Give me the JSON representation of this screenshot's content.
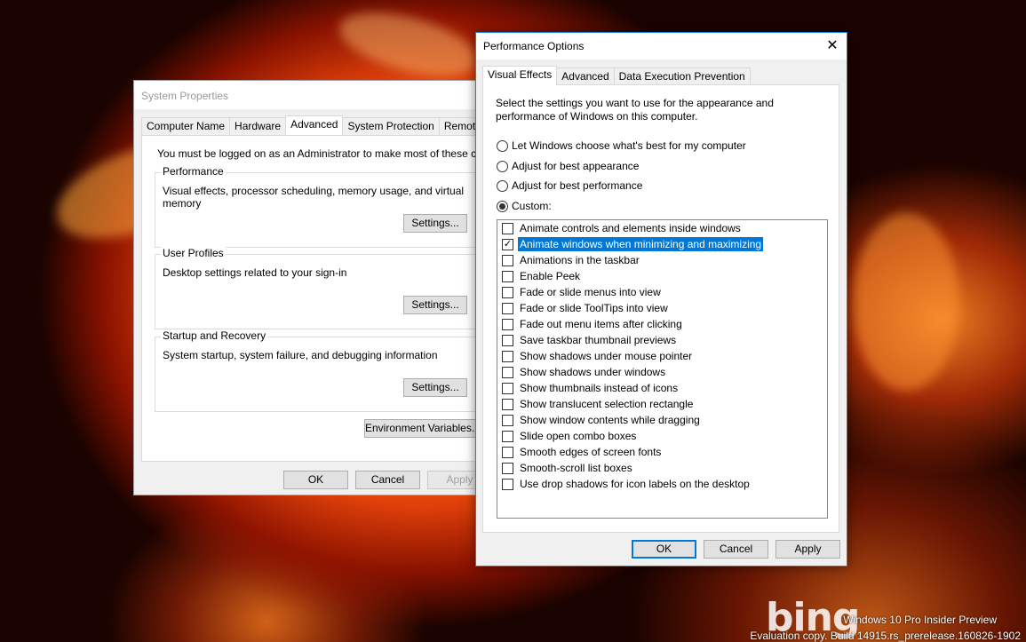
{
  "system_properties": {
    "title": "System Properties",
    "tabs": [
      {
        "label": "Computer Name",
        "active": false
      },
      {
        "label": "Hardware",
        "active": false
      },
      {
        "label": "Advanced",
        "active": true
      },
      {
        "label": "System Protection",
        "active": false
      },
      {
        "label": "Remote",
        "active": false
      }
    ],
    "admin_notice": "You must be logged on as an Administrator to make most of these changes.",
    "groups": [
      {
        "title": "Performance",
        "description": "Visual effects, processor scheduling, memory usage, and virtual memory",
        "button": "Settings..."
      },
      {
        "title": "User Profiles",
        "description": "Desktop settings related to your sign-in",
        "button": "Settings..."
      },
      {
        "title": "Startup and Recovery",
        "description": "System startup, system failure, and debugging information",
        "button": "Settings..."
      }
    ],
    "env_button": "Environment Variables...",
    "ok": "OK",
    "cancel": "Cancel",
    "apply": "Apply"
  },
  "performance_options": {
    "title": "Performance Options",
    "close_glyph": "✕",
    "tabs": [
      {
        "label": "Visual Effects",
        "active": true
      },
      {
        "label": "Advanced",
        "active": false
      },
      {
        "label": "Data Execution Prevention",
        "active": false
      }
    ],
    "intro": "Select the settings you want to use for the appearance and performance of Windows on this computer.",
    "radios": [
      {
        "label": "Let Windows choose what's best for my computer",
        "checked": false
      },
      {
        "label": "Adjust for best appearance",
        "checked": false
      },
      {
        "label": "Adjust for best performance",
        "checked": false
      },
      {
        "label": "Custom:",
        "checked": true
      }
    ],
    "effects": [
      {
        "label": "Animate controls and elements inside windows",
        "checked": false,
        "selected": false
      },
      {
        "label": "Animate windows when minimizing and maximizing",
        "checked": true,
        "selected": true
      },
      {
        "label": "Animations in the taskbar",
        "checked": false,
        "selected": false
      },
      {
        "label": "Enable Peek",
        "checked": false,
        "selected": false
      },
      {
        "label": "Fade or slide menus into view",
        "checked": false,
        "selected": false
      },
      {
        "label": "Fade or slide ToolTips into view",
        "checked": false,
        "selected": false
      },
      {
        "label": "Fade out menu items after clicking",
        "checked": false,
        "selected": false
      },
      {
        "label": "Save taskbar thumbnail previews",
        "checked": false,
        "selected": false
      },
      {
        "label": "Show shadows under mouse pointer",
        "checked": false,
        "selected": false
      },
      {
        "label": "Show shadows under windows",
        "checked": false,
        "selected": false
      },
      {
        "label": "Show thumbnails instead of icons",
        "checked": false,
        "selected": false
      },
      {
        "label": "Show translucent selection rectangle",
        "checked": false,
        "selected": false
      },
      {
        "label": "Show window contents while dragging",
        "checked": false,
        "selected": false
      },
      {
        "label": "Slide open combo boxes",
        "checked": false,
        "selected": false
      },
      {
        "label": "Smooth edges of screen fonts",
        "checked": false,
        "selected": false
      },
      {
        "label": "Smooth-scroll list boxes",
        "checked": false,
        "selected": false
      },
      {
        "label": "Use drop shadows for icon labels on the desktop",
        "checked": false,
        "selected": false
      }
    ],
    "ok": "OK",
    "cancel": "Cancel",
    "apply": "Apply"
  },
  "desktop": {
    "bing_logo": "bing",
    "watermark_line1": "Windows 10 Pro Insider Preview",
    "watermark_line2": "Evaluation copy. Build 14915.rs_prerelease.160826-1902"
  },
  "colors": {
    "accent": "#0078d7",
    "window_bg": "#f0f0f0",
    "selection": "#0078d7"
  }
}
